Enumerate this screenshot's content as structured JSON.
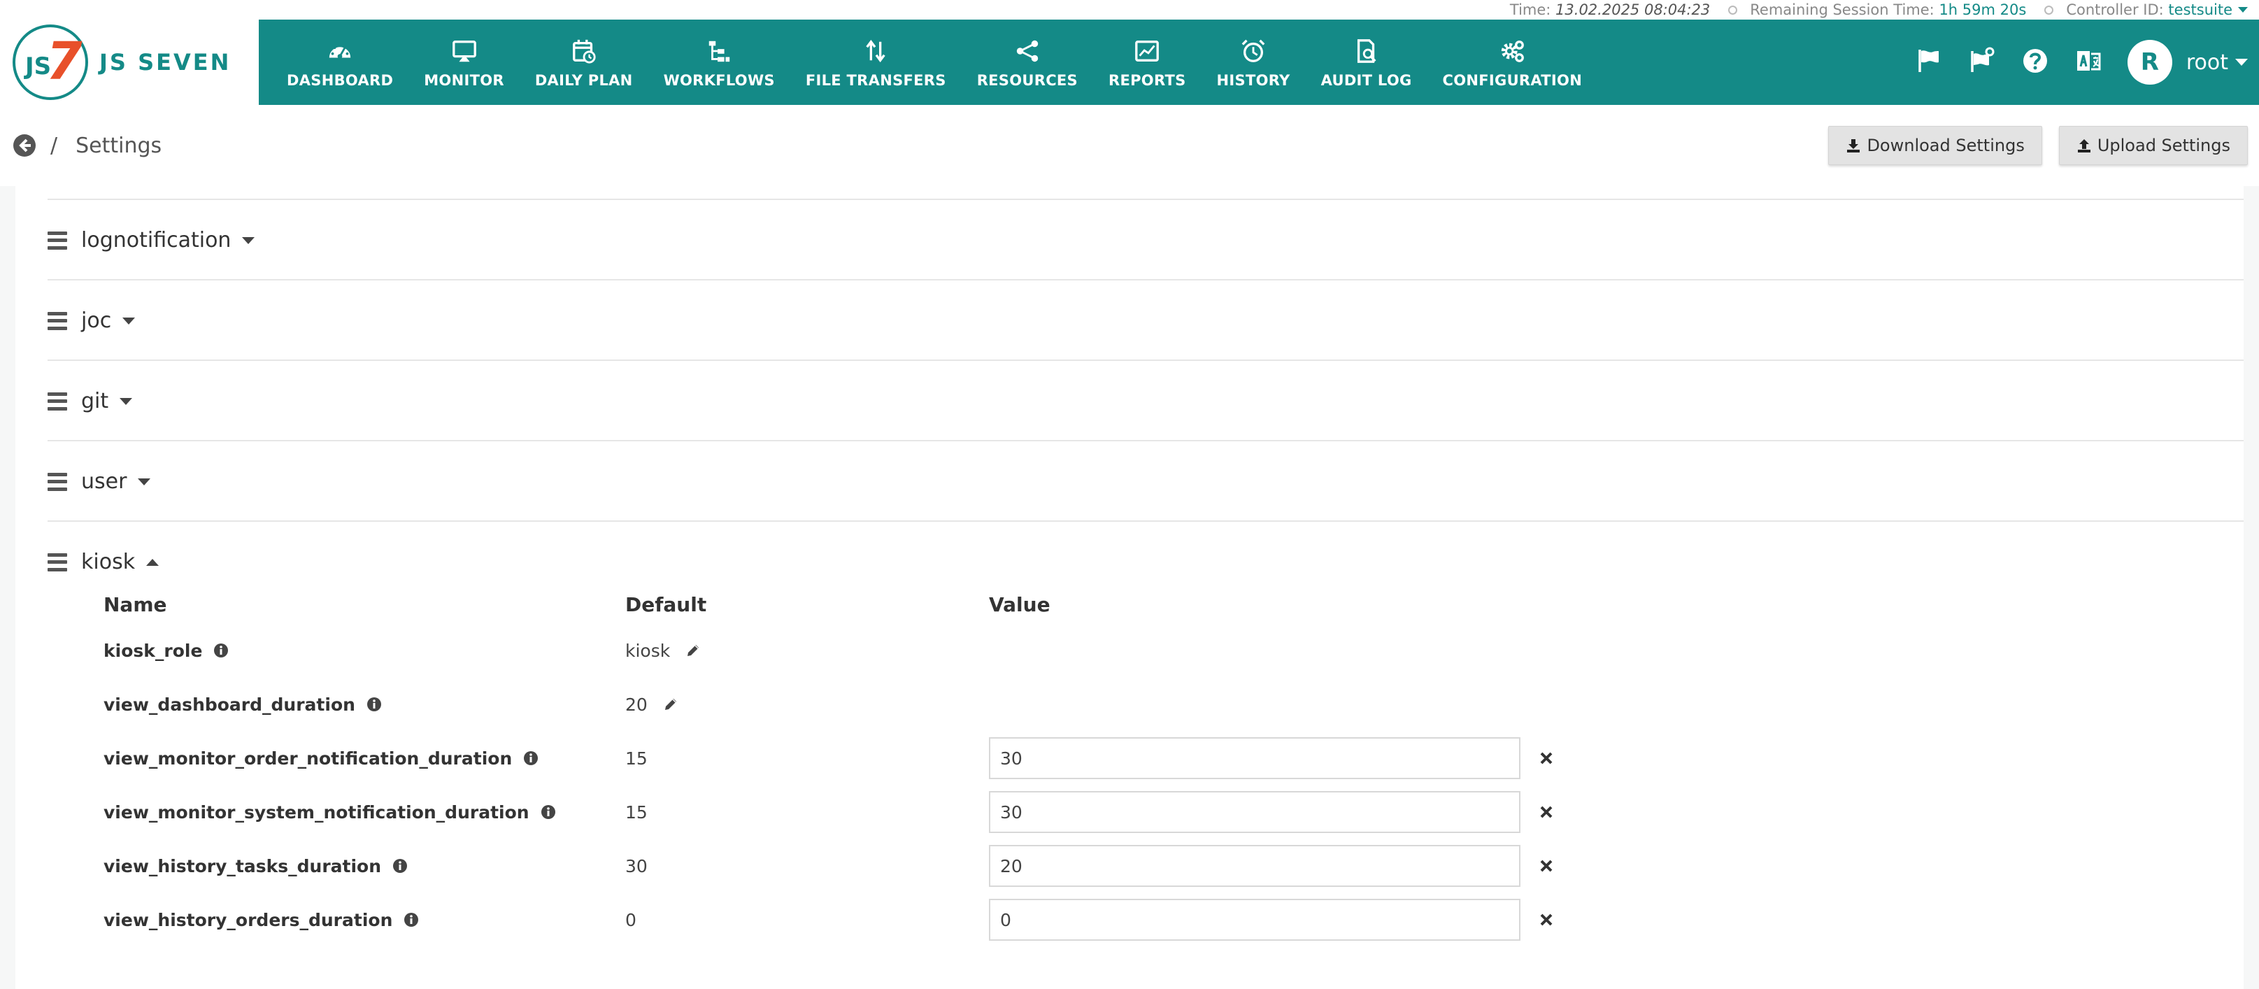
{
  "status": {
    "time_label": "Time:",
    "time_value": "13.02.2025 08:04:23",
    "session_label": "Remaining Session Time:",
    "session_value": "1h 59m 20s",
    "controller_label": "Controller ID:",
    "controller_value": "testsuite"
  },
  "brand": {
    "logo_js": "JS",
    "logo_seven": "7",
    "name": "JS SEVEN",
    "accent": "#148a87",
    "logo_accent": "#e8502a"
  },
  "nav": {
    "items": [
      {
        "label": "DASHBOARD",
        "icon": "dashboard-icon"
      },
      {
        "label": "MONITOR",
        "icon": "monitor-icon"
      },
      {
        "label": "DAILY PLAN",
        "icon": "calendar-icon"
      },
      {
        "label": "WORKFLOWS",
        "icon": "workflow-icon"
      },
      {
        "label": "FILE TRANSFERS",
        "icon": "transfer-icon"
      },
      {
        "label": "RESOURCES",
        "icon": "share-icon"
      },
      {
        "label": "REPORTS",
        "icon": "chart-icon"
      },
      {
        "label": "HISTORY",
        "icon": "alarm-icon"
      },
      {
        "label": "AUDIT LOG",
        "icon": "audit-icon"
      },
      {
        "label": "CONFIGURATION",
        "icon": "gears-icon"
      }
    ],
    "user_initial": "R",
    "user_name": "root"
  },
  "breadcrumb": {
    "separator": "/",
    "title": "Settings"
  },
  "toolbar": {
    "download_label": "Download Settings",
    "upload_label": "Upload Settings"
  },
  "sections": [
    {
      "name": "lognotification",
      "expanded": false
    },
    {
      "name": "joc",
      "expanded": false
    },
    {
      "name": "git",
      "expanded": false
    },
    {
      "name": "user",
      "expanded": false
    },
    {
      "name": "kiosk",
      "expanded": true
    }
  ],
  "kiosk": {
    "headers": {
      "name": "Name",
      "default": "Default",
      "value": "Value"
    },
    "rows": [
      {
        "name": "kiosk_role",
        "default": "kiosk",
        "value": ""
      },
      {
        "name": "view_dashboard_duration",
        "default": "20",
        "value": ""
      },
      {
        "name": "view_monitor_order_notification_duration",
        "default": "15",
        "value": "30"
      },
      {
        "name": "view_monitor_system_notification_duration",
        "default": "15",
        "value": "30"
      },
      {
        "name": "view_history_tasks_duration",
        "default": "30",
        "value": "20"
      },
      {
        "name": "view_history_orders_duration",
        "default": "0",
        "value": "0"
      }
    ]
  }
}
